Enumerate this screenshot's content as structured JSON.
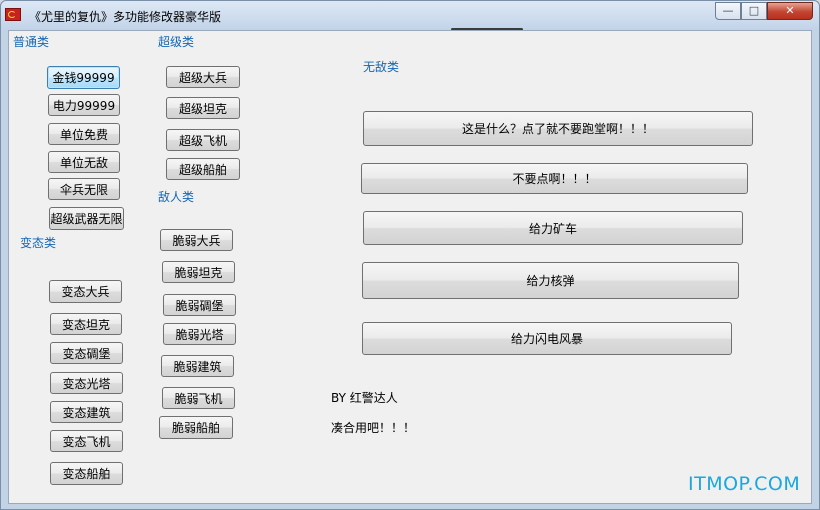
{
  "window": {
    "title": "《尤里的复仇》多功能修改器豪华版",
    "controls": {
      "minimize": "—",
      "maximize": "□",
      "close": "✕"
    }
  },
  "groups": {
    "normal": {
      "label": "普通类",
      "buttons": [
        "金钱99999",
        "电力99999",
        "单位免费",
        "单位无敌",
        "伞兵无限",
        "超级武器无限"
      ]
    },
    "super": {
      "label": "超级类",
      "buttons": [
        "超级大兵",
        "超级坦克",
        "超级飞机",
        "超级船舶"
      ]
    },
    "enemy": {
      "label": "敌人类",
      "buttons": [
        "脆弱大兵",
        "脆弱坦克",
        "脆弱碉堡",
        "脆弱光塔",
        "脆弱建筑",
        "脆弱飞机",
        "脆弱船舶"
      ]
    },
    "morph": {
      "label": "变态类",
      "buttons": [
        "变态大兵",
        "变态坦克",
        "变态碉堡",
        "变态光塔",
        "变态建筑",
        "变态飞机",
        "变态船舶"
      ]
    },
    "invincible": {
      "label": "无敌类",
      "buttons": [
        "这是什么？点了就不要跑堂啊！！！",
        "不要点啊！！！",
        "给力矿车",
        "给力核弹",
        "给力闪电风暴"
      ]
    }
  },
  "credits": {
    "author": "BY 红警达人",
    "note": "凑合用吧！！！"
  },
  "watermark": "ITMOP.COM"
}
